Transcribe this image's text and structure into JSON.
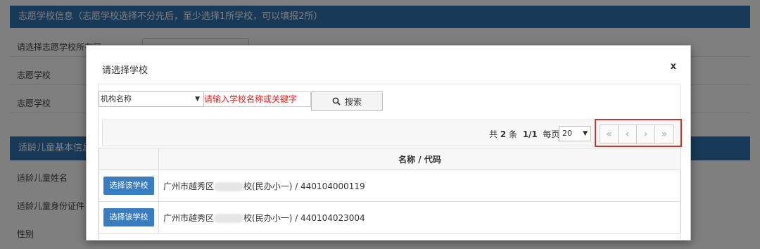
{
  "background": {
    "panel_header": "志愿学校信息（志愿学校选择不分先后，至少选择1所学校，可以填报2所）",
    "labels": [
      "请选择志愿学校所在区",
      "志愿学校",
      "志愿学校"
    ],
    "section_header": "适龄儿童基本信息",
    "labels_2": [
      "适龄儿童姓名",
      "适龄儿童身份证件",
      "性别"
    ]
  },
  "modal": {
    "title": "请选择学校",
    "close_label": "x",
    "filter": {
      "field_value": "机构名称",
      "keyword_placeholder": "请输入学校名称或关键字",
      "search_label": "搜索"
    },
    "pager": {
      "total_prefix": "共",
      "total_count": "2",
      "total_suffix": "条",
      "page": "1/1",
      "per_page_label": "每页",
      "per_page_value": "20",
      "buttons": [
        "«",
        "‹",
        "›",
        "»"
      ]
    },
    "table": {
      "header": "名称 / 代码",
      "rows": [
        {
          "action": "选择该学校",
          "name_prefix": "广州市越秀区",
          "name_suffix": "校(民办小一) / 440104000119"
        },
        {
          "action": "选择该学校",
          "name_prefix": "广州市越秀区",
          "name_suffix": "校(民办小一) / 440104023004"
        }
      ]
    }
  },
  "colors": {
    "header_blue": "#3174b0",
    "button_blue": "#3a7cc0",
    "highlight_red": "#c0392b",
    "placeholder_red": "#e02020"
  }
}
